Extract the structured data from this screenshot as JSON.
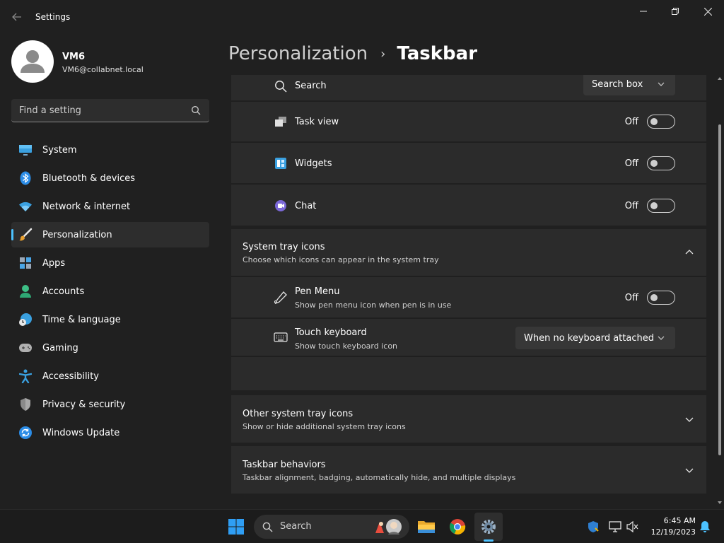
{
  "window": {
    "app_title": "Settings",
    "back_icon": "arrow-left-icon",
    "controls": [
      "minimize-icon",
      "restore-icon",
      "close-icon"
    ]
  },
  "user": {
    "name": "VM6",
    "email": "VM6@collabnet.local"
  },
  "search": {
    "placeholder": "Find a setting"
  },
  "sidebar": {
    "accent_color": "#4cc2ff",
    "items": [
      {
        "label": "System",
        "icon": "monitor-icon"
      },
      {
        "label": "Bluetooth & devices",
        "icon": "bluetooth-icon"
      },
      {
        "label": "Network & internet",
        "icon": "wifi-icon"
      },
      {
        "label": "Personalization",
        "icon": "brush-icon",
        "active": true
      },
      {
        "label": "Apps",
        "icon": "apps-icon"
      },
      {
        "label": "Accounts",
        "icon": "person-icon"
      },
      {
        "label": "Time & language",
        "icon": "globe-clock-icon"
      },
      {
        "label": "Gaming",
        "icon": "gamepad-icon"
      },
      {
        "label": "Accessibility",
        "icon": "accessibility-icon"
      },
      {
        "label": "Privacy & security",
        "icon": "shield-icon"
      },
      {
        "label": "Windows Update",
        "icon": "update-icon"
      }
    ]
  },
  "breadcrumb": {
    "parent": "Personalization",
    "separator": "›",
    "current": "Taskbar"
  },
  "taskbar_items": {
    "search": {
      "title": "Search",
      "value": "Search box"
    },
    "task_view": {
      "title": "Task view",
      "state": "Off"
    },
    "widgets": {
      "title": "Widgets",
      "state": "Off"
    },
    "chat": {
      "title": "Chat",
      "state": "Off"
    }
  },
  "system_tray": {
    "title": "System tray icons",
    "description": "Choose which icons can appear in the system tray",
    "pen_menu": {
      "title": "Pen Menu",
      "description": "Show pen menu icon when pen is in use",
      "state": "Off"
    },
    "touch_keyboard": {
      "title": "Touch keyboard",
      "description": "Show touch keyboard icon",
      "value": "When no keyboard attached"
    }
  },
  "other_tray": {
    "title": "Other system tray icons",
    "description": "Show or hide additional system tray icons"
  },
  "behaviors": {
    "title": "Taskbar behaviors",
    "description": "Taskbar alignment, badging, automatically hide, and multiple displays"
  },
  "os_taskbar": {
    "search_label": "Search",
    "apps": [
      "windows-start-icon",
      "file-explorer-icon",
      "chrome-icon",
      "settings-gear-icon"
    ],
    "tray": [
      "defender-shield-icon",
      "network-monitor-icon",
      "speaker-muted-icon",
      "notification-bell-icon"
    ],
    "time": "6:45 AM",
    "date": "12/19/2023"
  }
}
